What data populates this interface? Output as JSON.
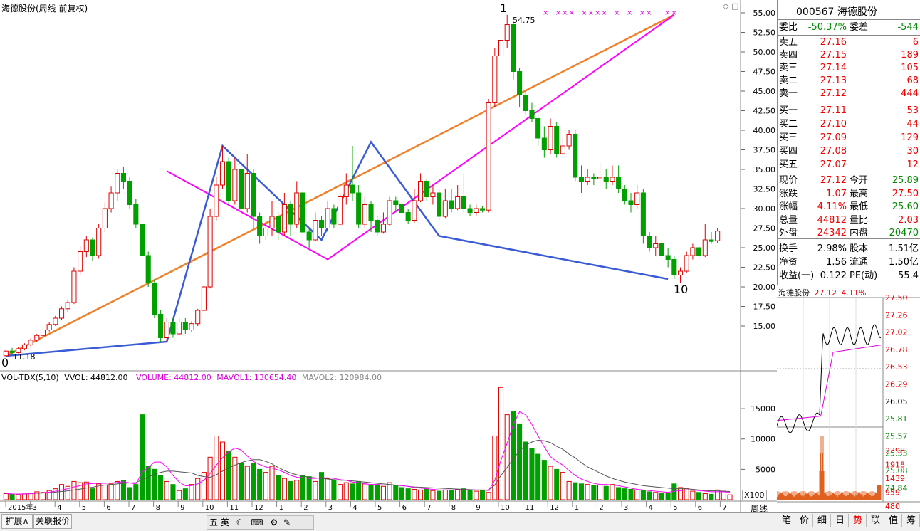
{
  "chart_title": "海德股份(周线 前复权)",
  "stock_header": "000567 海德股份",
  "zigzag_labels": {
    "start": "0",
    "peak": "1",
    "end": "10"
  },
  "price_annotations": {
    "high": "54.75",
    "low": "11.18"
  },
  "volume_header": {
    "indicator": "VOL-TDX(5,10)",
    "vvol": "VVOL: 44812.00",
    "volume": "VOLUME: 44812.00",
    "mavol1": "MAVOL1: 130654.40",
    "mavol2": "MAVOL2: 120984.00"
  },
  "x_ticks": [
    "2015年",
    "3",
    "4",
    "5",
    "6",
    "7",
    "8",
    "9",
    "10",
    "11",
    "12",
    "1",
    "2",
    "3",
    "4",
    "5",
    "6",
    "7",
    "8",
    "9",
    "10",
    "11",
    "12",
    "1",
    "2",
    "3",
    "4",
    "5",
    "6",
    "7"
  ],
  "period_label": "周线",
  "zoom_label": "X100",
  "bottom_buttons": {
    "expand": "扩展∧",
    "related": "关联报价"
  },
  "ime_bar": "五 英",
  "right_tabs": [
    "笔",
    "价",
    "细",
    "日",
    "势",
    "联",
    "值",
    "筹"
  ],
  "quote": {
    "weibi": {
      "label": "委比",
      "value": "-50.37%",
      "label2": "委差",
      "value2": "-544"
    },
    "asks": [
      {
        "label": "卖五",
        "price": "27.16",
        "vol": "6"
      },
      {
        "label": "卖四",
        "price": "27.15",
        "vol": "189"
      },
      {
        "label": "卖三",
        "price": "27.14",
        "vol": "105"
      },
      {
        "label": "卖二",
        "price": "27.13",
        "vol": "68"
      },
      {
        "label": "卖一",
        "price": "27.12",
        "vol": "444"
      }
    ],
    "bids": [
      {
        "label": "买一",
        "price": "27.11",
        "vol": "53"
      },
      {
        "label": "买二",
        "price": "27.10",
        "vol": "44"
      },
      {
        "label": "买三",
        "price": "27.09",
        "vol": "129"
      },
      {
        "label": "买四",
        "price": "27.08",
        "vol": "30"
      },
      {
        "label": "买五",
        "price": "27.07",
        "vol": "12"
      }
    ],
    "stats": [
      {
        "l1": "现价",
        "v1": "27.12",
        "l2": "今开",
        "v2": "25.89"
      },
      {
        "l1": "涨跌",
        "v1": "1.07",
        "l2": "最高",
        "v2": "27.50"
      },
      {
        "l1": "涨幅",
        "v1": "4.11%",
        "l2": "最低",
        "v2": "25.60"
      },
      {
        "l1": "总量",
        "v1": "44812",
        "l2": "量比",
        "v2": "2.03"
      },
      {
        "l1": "外盘",
        "v1": "24342",
        "l2": "内盘",
        "v2": "20470"
      }
    ],
    "fundamentals": [
      {
        "l1": "换手",
        "v1": "2.98%",
        "l2": "股本",
        "v2": "1.51亿"
      },
      {
        "l1": "净资",
        "v1": "1.56",
        "l2": "流通",
        "v2": "1.50亿"
      },
      {
        "l1": "收益(一)",
        "v1": "0.122",
        "l2": "PE(动)",
        "v2": "55.4"
      }
    ]
  },
  "colors": {
    "up": "#e00000",
    "down": "#00a000",
    "neutral": "#000000",
    "magenta": "#ff00ff",
    "blue": "#3a5bd6",
    "orange": "#f0802a"
  },
  "chart_data": [
    {
      "type": "candlestick",
      "title": "海德股份(周线 前复权)",
      "ylim": [
        10,
        56
      ],
      "yticks": [
        15.0,
        17.5,
        20.0,
        22.5,
        25.0,
        27.5,
        30.0,
        32.5,
        35.0,
        37.5,
        40.0,
        42.5,
        45.0,
        47.5,
        50.0,
        52.5,
        55.0
      ],
      "candles": [
        [
          11.2,
          11.8,
          11.0,
          12.0
        ],
        [
          11.8,
          11.6,
          11.3,
          12.2
        ],
        [
          11.6,
          12.1,
          11.5,
          12.3
        ],
        [
          12.1,
          12.6,
          11.9,
          12.8
        ],
        [
          12.6,
          13.2,
          12.4,
          13.4
        ],
        [
          13.2,
          13.8,
          13.0,
          14.0
        ],
        [
          13.8,
          14.5,
          13.6,
          14.7
        ],
        [
          14.5,
          15.2,
          14.3,
          15.5
        ],
        [
          15.2,
          16.0,
          15.0,
          16.3
        ],
        [
          16.0,
          17.2,
          15.8,
          17.5
        ],
        [
          17.2,
          18.0,
          16.8,
          18.4
        ],
        [
          18.0,
          22.0,
          17.8,
          22.5
        ],
        [
          22.0,
          24.5,
          21.5,
          25.2
        ],
        [
          24.5,
          26.0,
          23.8,
          26.5
        ],
        [
          26.0,
          24.0,
          23.3,
          26.3
        ],
        [
          24.0,
          27.5,
          23.6,
          28.0
        ],
        [
          27.5,
          30.0,
          27.0,
          30.8
        ],
        [
          30.0,
          32.0,
          29.5,
          32.8
        ],
        [
          32.0,
          34.5,
          31.0,
          35.0
        ],
        [
          34.5,
          33.5,
          32.5,
          35.3
        ],
        [
          33.5,
          30.5,
          30.0,
          34.0
        ],
        [
          30.5,
          28.0,
          27.5,
          31.2
        ],
        [
          28.0,
          24.0,
          23.5,
          28.5
        ],
        [
          24.0,
          20.5,
          20.0,
          24.5
        ],
        [
          20.5,
          16.5,
          16.0,
          21.0
        ],
        [
          16.5,
          13.5,
          13.0,
          17.0
        ],
        [
          13.5,
          15.5,
          13.0,
          16.0
        ],
        [
          15.5,
          14.0,
          13.5,
          16.0
        ],
        [
          14.0,
          15.5,
          13.8,
          16.0
        ],
        [
          15.5,
          14.5,
          14.0,
          16.0
        ],
        [
          14.5,
          15.3,
          14.2,
          15.6
        ],
        [
          15.3,
          17.0,
          15.0,
          17.2
        ],
        [
          17.0,
          20.0,
          16.8,
          20.3
        ],
        [
          20.0,
          29.0,
          19.8,
          30.0
        ],
        [
          29.0,
          33.0,
          28.5,
          34.0
        ],
        [
          33.0,
          36.0,
          32.5,
          38.0
        ],
        [
          36.0,
          31.0,
          30.5,
          36.5
        ],
        [
          31.0,
          35.0,
          30.5,
          36.5
        ],
        [
          35.0,
          30.0,
          28.0,
          35.5
        ],
        [
          30.0,
          34.5,
          29.5,
          37.0
        ],
        [
          34.5,
          29.0,
          27.5,
          35.0
        ],
        [
          29.0,
          26.5,
          25.5,
          29.5
        ],
        [
          26.5,
          27.5,
          26.0,
          28.5
        ],
        [
          27.5,
          29.0,
          26.5,
          31.0
        ],
        [
          29.0,
          27.0,
          26.0,
          29.5
        ],
        [
          27.0,
          30.5,
          26.5,
          32.0
        ],
        [
          30.5,
          28.0,
          26.5,
          31.0
        ],
        [
          28.0,
          32.0,
          27.5,
          33.5
        ],
        [
          32.0,
          27.0,
          25.5,
          32.5
        ],
        [
          27.0,
          26.0,
          25.0,
          27.5
        ],
        [
          26.0,
          28.5,
          25.8,
          29.5
        ],
        [
          28.5,
          27.5,
          26.5,
          29.0
        ],
        [
          27.5,
          30.0,
          27.0,
          31.0
        ],
        [
          30.0,
          28.0,
          27.5,
          30.5
        ],
        [
          28.0,
          31.5,
          27.8,
          32.0
        ],
        [
          31.5,
          33.0,
          30.5,
          34.5
        ],
        [
          33.0,
          32.0,
          31.0,
          38.0
        ],
        [
          32.0,
          28.0,
          27.5,
          33.0
        ],
        [
          28.0,
          30.5,
          27.5,
          31.5
        ],
        [
          30.5,
          28.5,
          27.0,
          31.0
        ],
        [
          28.5,
          27.0,
          26.5,
          29.0
        ],
        [
          27.0,
          28.0,
          26.8,
          29.5
        ],
        [
          28.0,
          31.0,
          27.8,
          31.5
        ],
        [
          31.0,
          30.5,
          29.5,
          31.5
        ],
        [
          30.5,
          29.5,
          28.8,
          31.0
        ],
        [
          29.5,
          28.5,
          28.0,
          30.0
        ],
        [
          28.5,
          31.0,
          28.2,
          32.5
        ],
        [
          31.0,
          33.5,
          30.8,
          34.5
        ],
        [
          33.5,
          31.5,
          31.0,
          33.8
        ],
        [
          31.5,
          32.0,
          30.5,
          33.0
        ],
        [
          32.0,
          29.0,
          28.5,
          32.5
        ],
        [
          29.0,
          31.0,
          28.8,
          32.5
        ],
        [
          31.0,
          30.0,
          29.5,
          32.5
        ],
        [
          30.0,
          31.5,
          29.8,
          33.0
        ],
        [
          31.5,
          30.0,
          29.5,
          34.5
        ],
        [
          30.0,
          29.5,
          29.0,
          30.5
        ],
        [
          29.5,
          30.0,
          29.0,
          30.5
        ],
        [
          30.0,
          29.8,
          29.5,
          30.3
        ],
        [
          29.8,
          43.5,
          29.5,
          44.0
        ],
        [
          43.5,
          49.5,
          43.0,
          50.5
        ],
        [
          49.5,
          51.5,
          48.5,
          53.0
        ],
        [
          51.5,
          53.5,
          50.5,
          54.75
        ],
        [
          53.5,
          47.5,
          46.5,
          54.0
        ],
        [
          47.5,
          44.5,
          43.0,
          48.0
        ],
        [
          44.5,
          42.5,
          42.0,
          45.0
        ],
        [
          42.5,
          41.5,
          41.0,
          43.5
        ],
        [
          41.5,
          39.0,
          38.0,
          42.0
        ],
        [
          39.0,
          37.5,
          36.5,
          40.5
        ],
        [
          37.5,
          40.5,
          37.0,
          41.5
        ],
        [
          40.5,
          37.0,
          36.5,
          41.0
        ],
        [
          37.0,
          38.0,
          36.8,
          39.0
        ],
        [
          38.0,
          39.5,
          37.5,
          40.0
        ],
        [
          39.5,
          34.0,
          33.5,
          40.0
        ],
        [
          34.0,
          33.5,
          32.0,
          35.5
        ],
        [
          33.5,
          34.0,
          33.0,
          35.0
        ],
        [
          34.0,
          33.8,
          33.0,
          34.5
        ],
        [
          33.8,
          34.0,
          33.2,
          36.0
        ],
        [
          34.0,
          33.5,
          32.5,
          35.0
        ],
        [
          33.5,
          34.0,
          33.0,
          35.5
        ],
        [
          34.0,
          32.5,
          32.0,
          35.5
        ],
        [
          32.5,
          31.0,
          30.5,
          33.0
        ],
        [
          31.0,
          30.5,
          29.5,
          32.0
        ],
        [
          30.5,
          32.0,
          30.0,
          33.0
        ],
        [
          32.0,
          26.5,
          25.5,
          32.5
        ],
        [
          26.5,
          25.0,
          24.5,
          27.0
        ],
        [
          25.0,
          25.5,
          24.0,
          26.5
        ],
        [
          25.5,
          24.0,
          23.5,
          26.0
        ],
        [
          24.0,
          23.5,
          22.5,
          25.0
        ],
        [
          23.5,
          21.5,
          21.0,
          24.0
        ],
        [
          21.5,
          22.0,
          20.5,
          22.5
        ],
        [
          22.0,
          24.0,
          21.8,
          24.5
        ],
        [
          24.0,
          25.0,
          23.5,
          25.5
        ],
        [
          25.0,
          24.0,
          23.5,
          25.2
        ],
        [
          24.0,
          26.0,
          23.8,
          28.0
        ],
        [
          26.0,
          25.8,
          25.5,
          27.0
        ],
        [
          25.89,
          27.12,
          25.6,
          27.5
        ]
      ],
      "zigzag": {
        "blue": [
          [
            0,
            11.18
          ],
          [
            26,
            13.0
          ],
          [
            35,
            38.0
          ],
          [
            51,
            26.0
          ],
          [
            59,
            38.5
          ],
          [
            70,
            26.5
          ],
          [
            107,
            21.0
          ]
        ],
        "magenta": [
          [
            26,
            34.8
          ],
          [
            52,
            23.5
          ],
          [
            108,
            54.75
          ]
        ],
        "orange": [
          [
            0,
            11.18
          ],
          [
            108,
            54.75
          ]
        ]
      }
    },
    {
      "type": "bar",
      "title": "VOL-TDX(5,10)",
      "yticks": [
        5000,
        10000,
        15000
      ],
      "ylim": [
        0,
        19000
      ],
      "volumes": [
        1000,
        900,
        800,
        950,
        1100,
        1300,
        1200,
        1500,
        1800,
        2500,
        2200,
        3000,
        2800,
        2900,
        1800,
        2600,
        2400,
        2600,
        3000,
        3200,
        2000,
        2500,
        14000,
        5500,
        5000,
        4000,
        3000,
        2500,
        1500,
        1800,
        2500,
        3500,
        4500,
        7000,
        10500,
        9500,
        8000,
        7000,
        6000,
        5500,
        6000,
        5000,
        4500,
        5500,
        4000,
        3500,
        3000,
        3200,
        4000,
        3800,
        3000,
        4500,
        3500,
        3200,
        2500,
        2800,
        2600,
        3000,
        2600,
        2400,
        2500,
        2200,
        2800,
        2400,
        2000,
        1800,
        1700,
        1600,
        1800,
        1500,
        1400,
        1600,
        1500,
        1700,
        1800,
        1600,
        1400,
        1500,
        1200,
        10500,
        18500,
        14000,
        14500,
        12500,
        9500,
        8500,
        7500,
        6500,
        5500,
        5000,
        4500,
        3000,
        2800,
        2600,
        2500,
        2400,
        2400,
        2200,
        2500,
        2000,
        1800,
        1700,
        1600,
        1500,
        1300,
        1200,
        1100,
        1000,
        2600,
        2000,
        1800,
        1400,
        1200,
        1000,
        900,
        1600,
        1400,
        800
      ],
      "mavol1_points": [
        1000,
        950,
        930,
        950,
        980,
        1100,
        1150,
        1250,
        1400,
        1600,
        1800,
        2100,
        2300,
        2600,
        2650,
        2700,
        2700,
        2750,
        2850,
        2950,
        2750,
        2600,
        4500,
        5300,
        6200,
        6200,
        5400,
        4000,
        2900,
        2300,
        2300,
        2600,
        3200,
        4300,
        5700,
        6900,
        7900,
        8500,
        8200,
        7200,
        6300,
        5800,
        5400,
        5200,
        4900,
        4500,
        4000,
        3700,
        3600,
        3500,
        3500,
        3600,
        3600,
        3500,
        3300,
        3200,
        2900,
        2800,
        2600,
        2500,
        2500,
        2400,
        2400,
        2400,
        2300,
        2200,
        2000,
        1900,
        1800,
        1700,
        1600,
        1600,
        1600,
        1600,
        1600,
        1600,
        1600,
        1600,
        1500,
        3200,
        6500,
        9300,
        12400,
        14500,
        14000,
        12400,
        10500,
        8700,
        7100,
        6300,
        5700,
        4800,
        4000,
        3400,
        3000,
        2700,
        2500,
        2500,
        2400,
        2300,
        2100,
        1900,
        1700,
        1600,
        1500,
        1400,
        1300,
        1200,
        1400,
        1500,
        1600,
        1600,
        1500,
        1400,
        1300,
        1300,
        1300,
        1200
      ],
      "mavol2_points": [
        1000,
        950,
        930,
        950,
        980,
        1050,
        1100,
        1150,
        1250,
        1350,
        1450,
        1600,
        1750,
        1900,
        2050,
        2250,
        2400,
        2500,
        2600,
        2700,
        2750,
        2800,
        3300,
        3700,
        4200,
        4500,
        4700,
        4700,
        4600,
        4500,
        4400,
        4000,
        3800,
        3700,
        4100,
        4700,
        5200,
        5700,
        6100,
        6400,
        6600,
        6600,
        6300,
        5900,
        5300,
        4800,
        4400,
        4100,
        3900,
        3700,
        3600,
        3500,
        3400,
        3300,
        3200,
        3200,
        3100,
        3000,
        2900,
        2800,
        2700,
        2600,
        2500,
        2400,
        2300,
        2200,
        2100,
        2050,
        2000,
        1950,
        1900,
        1850,
        1800,
        1750,
        1700,
        1650,
        1600,
        1600,
        1600,
        2400,
        4000,
        5300,
        6800,
        8000,
        9000,
        9500,
        9800,
        9700,
        9400,
        8800,
        8300,
        7500,
        6900,
        6100,
        5400,
        4900,
        4400,
        3900,
        3500,
        3200,
        2900,
        2700,
        2500,
        2300,
        2200,
        2100,
        2000,
        1900,
        1800,
        1800,
        1800,
        1700,
        1600,
        1500,
        1450,
        1450,
        1400,
        1350
      ]
    },
    {
      "type": "line",
      "title": "海德股份 27.12 4.11%",
      "ylim": [
        24.6,
        27.55
      ],
      "yticks": [
        "27.50",
        "27.26",
        "27.02",
        "26.78",
        "26.53",
        "26.29",
        "26.05",
        "25.81",
        "25.57",
        "25.33",
        "25.08",
        "24.84"
      ],
      "prev_close": "26.05",
      "right_pct": "4.11%",
      "volume_ticks": [
        "2398",
        "1918",
        "1439",
        "959",
        "480"
      ]
    }
  ]
}
